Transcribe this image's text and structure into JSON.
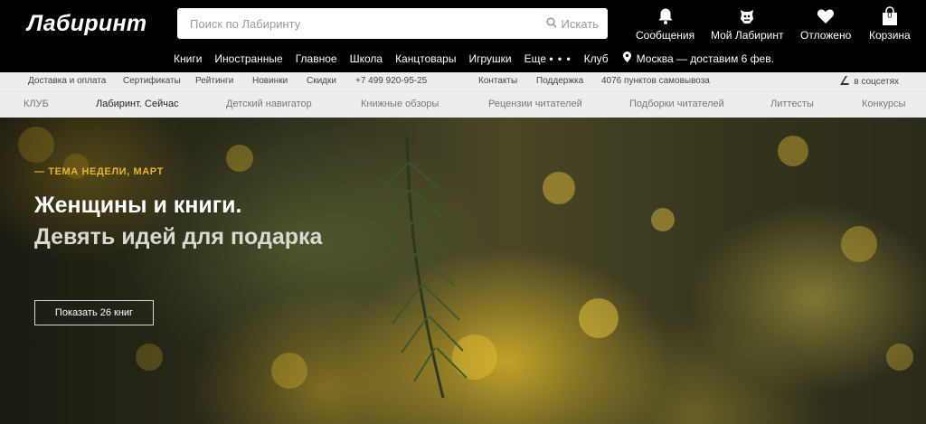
{
  "header": {
    "logo": "Лабиринт",
    "search": {
      "placeholder": "Поиск по Лабиринту",
      "button_label": "Искать"
    },
    "icons": [
      {
        "label": "Сообщения",
        "icon": "bell-icon"
      },
      {
        "label": "Мой Лабиринт",
        "icon": "minotaur-icon"
      },
      {
        "label": "Отложено",
        "icon": "heart-icon"
      },
      {
        "label": "Корзина",
        "icon": "bag-icon",
        "count": "0"
      }
    ],
    "categories": [
      "Книги",
      "Иностранные",
      "Главное",
      "Школа",
      "Канцтовары",
      "Игрушки",
      "Еще",
      "Клуб"
    ],
    "more_dots": "• • •",
    "location": "Москва — доставим 6 фев."
  },
  "utility": {
    "links": [
      "Доставка и оплата",
      "Сертификаты",
      "Рейтинги",
      "Новинки",
      "Скидки",
      "+7 499 920-95-25",
      "Контакты",
      "Поддержка",
      "4076 пунктов самовывоза"
    ],
    "social_label": "в соцсетях"
  },
  "section_nav": {
    "items": [
      "КЛУБ",
      "Лабиринт. Сейчас",
      "Детский навигатор",
      "Книжные обзоры",
      "Рецензии читателей",
      "Подборки читателей",
      "Литтесты",
      "Конкурсы"
    ],
    "active_index": 1
  },
  "hero": {
    "kicker": "— ТЕМА НЕДЕЛИ, МАРТ",
    "title_line1": "Женщины и книги.",
    "title_line2": "Девять идей для подарка",
    "button_label": "Показать 26 книг"
  },
  "colors": {
    "header_bg": "#000000",
    "utility_bg": "#ededed",
    "accent_kicker": "#e8b430"
  }
}
